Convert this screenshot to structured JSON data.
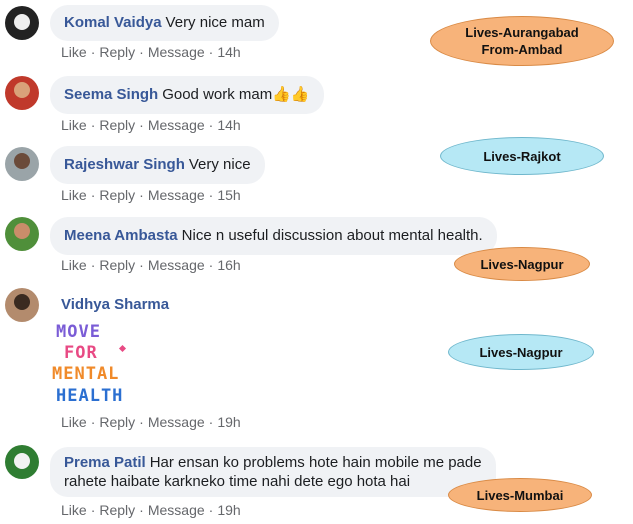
{
  "actions": {
    "like": "Like",
    "reply": "Reply",
    "message": "Message",
    "sep": "·"
  },
  "comments": [
    {
      "name": "Komal Vaidya",
      "text": "Very nice mam",
      "time": "14h"
    },
    {
      "name": "Seema Singh",
      "text": "Good work mam👍👍",
      "time": "14h"
    },
    {
      "name": "Rajeshwar Singh",
      "text": "Very nice",
      "time": "15h"
    },
    {
      "name": "Meena Ambasta",
      "text": "Nice n useful discussion about mental health.",
      "time": "16h"
    },
    {
      "name": "Vidhya Sharma",
      "text": "",
      "time": "19h"
    },
    {
      "name": "Prema Patil",
      "text_line1": "Har ensan ko problems hote hain mobile me pade",
      "text_line2": "rahete haibate karkneko time nahi dete ego hota hai",
      "time": "19h"
    }
  ],
  "sticker": {
    "line1": "MOVE",
    "line2": "FOR",
    "line3": "MENTAL",
    "line4": "HEALTH"
  },
  "annotations": [
    {
      "line1": "Lives-Aurangabad",
      "line2": "From-Ambad",
      "color": "orange"
    },
    {
      "text": "Lives-Rajkot",
      "color": "blue"
    },
    {
      "text": "Lives-Nagpur",
      "color": "orange"
    },
    {
      "text": "Lives-Nagpur",
      "color": "blue"
    },
    {
      "text": "Lives-Mumbai",
      "color": "orange"
    }
  ]
}
